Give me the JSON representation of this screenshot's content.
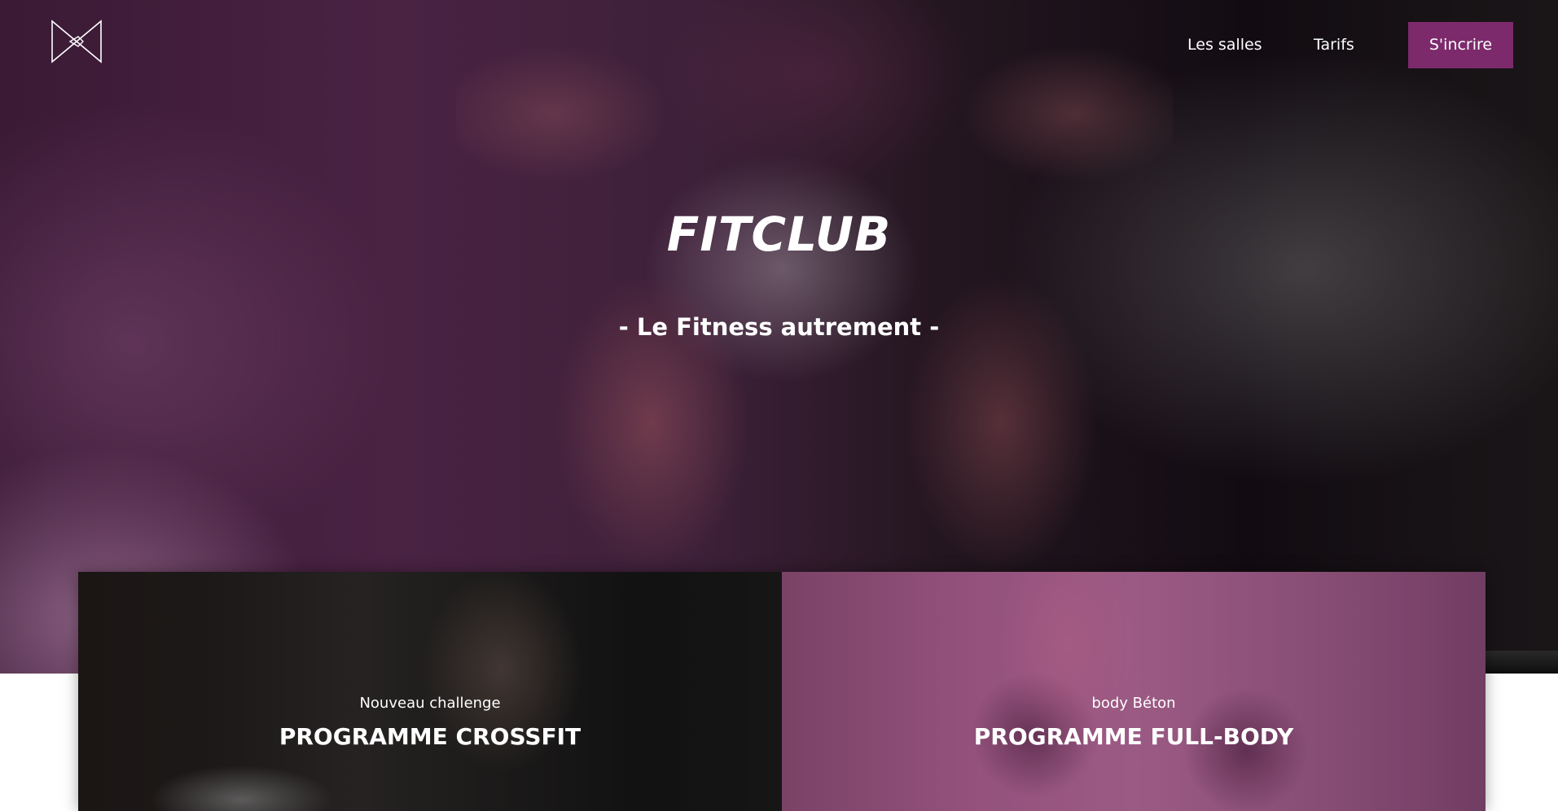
{
  "header": {
    "logo_icon": "bowtie-logo-icon",
    "nav": {
      "les_salles": "Les salles",
      "tarifs": "Tarifs",
      "signup": "S'incrire"
    },
    "accent_color": "#7d2a6d"
  },
  "hero": {
    "title": "FITCLUB",
    "subtitle": "- Le Fitness autrement -"
  },
  "programs": [
    {
      "kicker": "Nouveau challenge",
      "title": "PROGRAMME CROSSFIT"
    },
    {
      "kicker": "body Béton",
      "title": "PROGRAMME FULL-BODY"
    }
  ]
}
